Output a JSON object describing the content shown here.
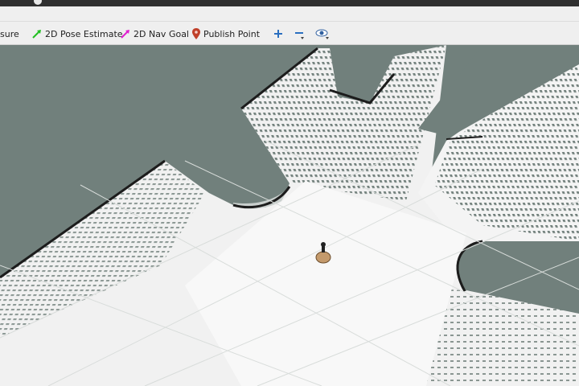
{
  "toolbar": {
    "tools": [
      {
        "label": "sure",
        "icon": "measure-icon"
      },
      {
        "label": "2D Pose Estimate",
        "icon": "green-arrow-icon",
        "color": "#22c022"
      },
      {
        "label": "2D Nav Goal",
        "icon": "magenta-arrow-icon",
        "color": "#e020d0"
      },
      {
        "label": "Publish Point",
        "icon": "map-pin-icon",
        "color": "#c0402a"
      }
    ],
    "zoom_in": "plus-icon",
    "zoom_out": "minus-icon",
    "view": "eye-icon"
  },
  "colors": {
    "unknown": "#71807c",
    "free": "#f4f4f4",
    "wall": "#1c1c1c"
  }
}
